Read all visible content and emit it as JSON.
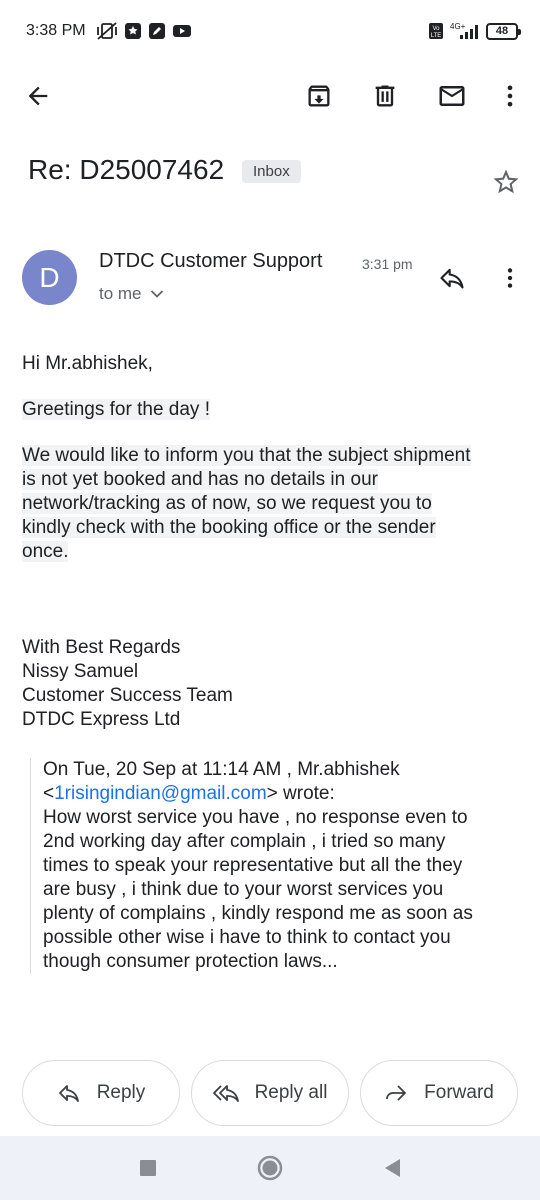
{
  "status_bar": {
    "time": "3:38 PM",
    "network": "4G+",
    "volte": "Vo LTE",
    "battery": "48"
  },
  "toolbar": {
    "icons": [
      "back-arrow-icon",
      "archive-icon",
      "delete-icon",
      "mail-icon",
      "more-vert-icon"
    ]
  },
  "email": {
    "subject": "Re: D25007462",
    "label": "Inbox",
    "sender": {
      "initial": "D",
      "name": "DTDC Customer Support",
      "time": "3:31 pm",
      "recipient": "to me",
      "avatar_color": "#7986cb"
    },
    "body": {
      "greeting": "Hi Mr.abhishek,",
      "line1": "Greetings for the day !",
      "para1_lines": [
        "We would like to inform you that the subject shipment",
        "is not yet booked and has no details in our",
        "network/tracking as of now, so we request you to",
        "kindly check with the booking office or the sender",
        "once."
      ],
      "signature": [
        "With Best Regards",
        "Nissy Samuel",
        "Customer Success Team",
        "DTDC Express Ltd"
      ]
    },
    "quote": {
      "header_line1": "On Tue, 20 Sep at 11:14 AM , Mr.abhishek",
      "header_open": "<",
      "email": "1risingindian@gmail.com",
      "header_close": "> wrote:",
      "lines": [
        "How worst service you have , no response even to",
        "2nd working day after complain , i tried so many",
        "times to speak your representative but all the they",
        "are busy , i think due to your worst services you",
        "plenty of complains , kindly respond me as soon as",
        "possible other wise i have to think to contact you",
        "though consumer protection laws..."
      ]
    }
  },
  "actions": {
    "reply": "Reply",
    "reply_all": "Reply all",
    "forward": "Forward"
  },
  "colors": {
    "link": "#1a73e8",
    "nav_bg": "#eef1f8",
    "chip_bg": "#e8eaed"
  }
}
